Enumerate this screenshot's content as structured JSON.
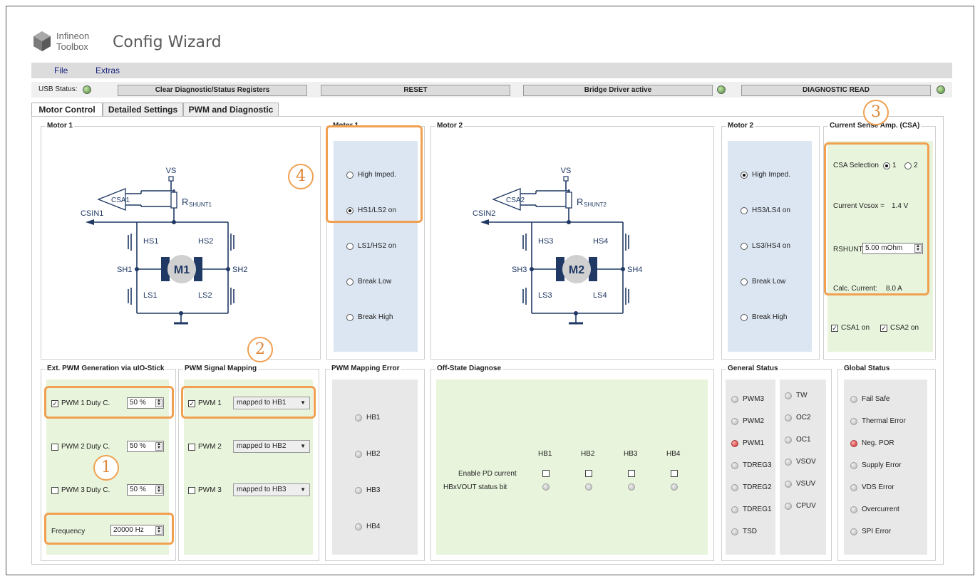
{
  "app": {
    "logo_line1": "Infineon",
    "logo_line2": "Toolbox",
    "title": "Config Wizard"
  },
  "menu": {
    "file": "File",
    "extras": "Extras"
  },
  "toolbar": {
    "usb_status": "USB Status:",
    "clear": "Clear Diagnostic/Status Registers",
    "reset": "RESET",
    "bridge": "Bridge Driver active",
    "diag": "DIAGNOSTIC READ"
  },
  "tabs": [
    "Motor Control",
    "Detailed Settings",
    "PWM and Diagnostic"
  ],
  "motor1_diagram": {
    "title": "Motor 1",
    "vs": "VS",
    "csa": "CSA1",
    "rshunt": "R",
    "rshunt_sub": "SHUNT1",
    "csin": "CSIN1",
    "hs_left": "HS1",
    "hs_right": "HS2",
    "sh_left": "SH1",
    "sh_right": "SH2",
    "ls_left": "LS1",
    "ls_right": "LS2",
    "motor": "M1"
  },
  "motor1_mode": {
    "title": "Motor 1",
    "options": [
      "High Imped.",
      "HS1/LS2 on",
      "LS1/HS2 on",
      "Break Low",
      "Break High"
    ],
    "selected": 1
  },
  "motor2_diagram": {
    "title": "Motor 2",
    "vs": "VS",
    "csa": "CSA2",
    "rshunt": "R",
    "rshunt_sub": "SHUNT2",
    "csin": "CSIN2",
    "hs_left": "HS3",
    "hs_right": "HS4",
    "sh_left": "SH3",
    "sh_right": "SH4",
    "ls_left": "LS3",
    "ls_right": "LS4",
    "motor": "M2"
  },
  "motor2_mode": {
    "title": "Motor 2",
    "options": [
      "High Imped.",
      "HS3/LS4 on",
      "LS3/HS4 on",
      "Break Low",
      "Break High"
    ],
    "selected": 0
  },
  "csa": {
    "title": "Current Sense Amp. (CSA)",
    "selection_label": "CSA Selection",
    "opt1": "1",
    "opt2": "2",
    "vcsox_label": "Current Vcsox =",
    "vcsox_value": "1.4 V",
    "rshunt_label": "RSHUNT",
    "rshunt_value": "5.00 mOhm",
    "calc_label": "Calc. Current:",
    "calc_value": "8.0  A",
    "csa1_on": "CSA1 on",
    "csa2_on": "CSA2 on"
  },
  "ext_pwm": {
    "title": "Ext. PWM Generation via uIO-Stick",
    "rows": [
      {
        "label": "PWM 1",
        "duty": "Duty C.",
        "value": "50 %",
        "checked": true
      },
      {
        "label": "PWM 2",
        "duty": "Duty C.",
        "value": "50 %",
        "checked": false
      },
      {
        "label": "PWM 3",
        "duty": "Duty C.",
        "value": "50 %",
        "checked": false
      }
    ],
    "freq_label": "Frequency",
    "freq_value": "20000 Hz"
  },
  "pwm_map": {
    "title": "PWM Signal Mapping",
    "rows": [
      {
        "label": "PWM 1",
        "value": "mapped to HB1",
        "checked": true
      },
      {
        "label": "PWM 2",
        "value": "mapped to HB2",
        "checked": false
      },
      {
        "label": "PWM 3",
        "value": "mapped to HB3",
        "checked": false
      }
    ]
  },
  "pwm_err": {
    "title": "PWM Mapping Error",
    "items": [
      "HB1",
      "HB2",
      "HB3",
      "HB4"
    ]
  },
  "offstate": {
    "title": "Off-State Diagnose",
    "headers": [
      "HB1",
      "HB2",
      "HB3",
      "HB4"
    ],
    "row1": "Enable PD current",
    "row2": "HBxVOUT status bit"
  },
  "general": {
    "title": "General Status",
    "col1": [
      "PWM3",
      "PWM2",
      "PWM1",
      "TDREG3",
      "TDREG2",
      "TDREG1",
      "TSD"
    ],
    "col2": [
      "TW",
      "OC2",
      "OC1",
      "VSOV",
      "VSUV",
      "CPUV"
    ]
  },
  "global": {
    "title": "Global Status",
    "items": [
      "Fail Safe",
      "Thermal Error",
      "Neg. POR",
      "Supply Error",
      "VDS Error",
      "Overcurrent",
      "SPI Error"
    ]
  },
  "badges": [
    "1",
    "2",
    "3",
    "4"
  ],
  "colors": {
    "highlight": "#f0a050",
    "blue_fill": "#dce6f2",
    "green_fill": "#e8f4dc",
    "gray_fill": "#e8e8e8",
    "circuit": "#1f3864"
  }
}
